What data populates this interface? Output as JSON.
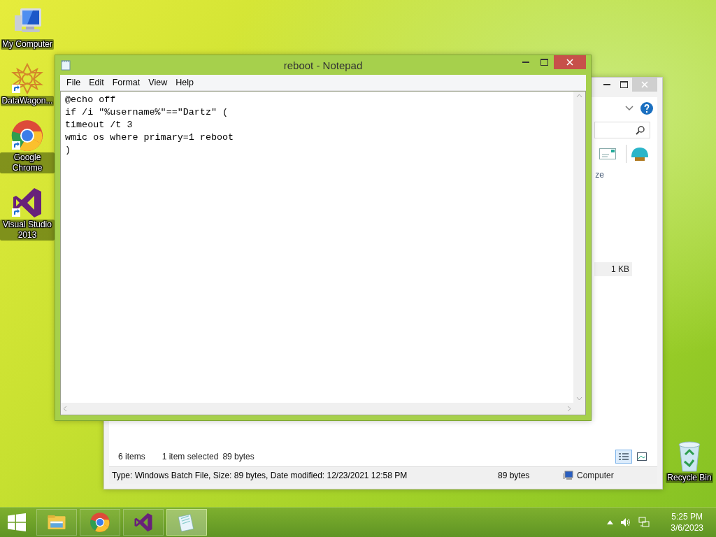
{
  "desktop_icons": [
    {
      "kind": "computer",
      "label": "My Computer"
    },
    {
      "kind": "datawagon",
      "label": "DataWagon..."
    },
    {
      "kind": "chrome",
      "label": "Google Chrome"
    },
    {
      "kind": "visualstudio",
      "label": "Visual Studio 2013"
    }
  ],
  "recycle_bin": {
    "label": "Recycle Bin"
  },
  "explorer": {
    "column_header": "ze",
    "size_cell": "1 KB",
    "item_count": "6 items",
    "selection": "1 item selected",
    "selection_size": "89 bytes",
    "views": [
      {
        "kind": "details",
        "selected": true
      },
      {
        "kind": "thumbnails",
        "selected": false
      }
    ],
    "status_bar": {
      "info": "Type: Windows Batch File, Size: 89 bytes, Date modified: 12/23/2021 12:58 PM",
      "size": "89 bytes",
      "zone": "Computer"
    }
  },
  "notepad": {
    "title": "reboot - Notepad",
    "menu": [
      "File",
      "Edit",
      "Format",
      "View",
      "Help"
    ],
    "lines": [
      "@echo off",
      "if /i \"%username%\"==\"Dartz\" (",
      "timeout /t 3",
      "wmic os where primary=1 reboot",
      ")"
    ]
  },
  "taskbar": {
    "apps": [
      {
        "kind": "explorer",
        "selected": false
      },
      {
        "kind": "chrome",
        "selected": false
      },
      {
        "kind": "visualstudio",
        "selected": false
      },
      {
        "kind": "notepad",
        "selected": true
      }
    ],
    "time": "5:25 PM",
    "date": "3/6/2023"
  }
}
